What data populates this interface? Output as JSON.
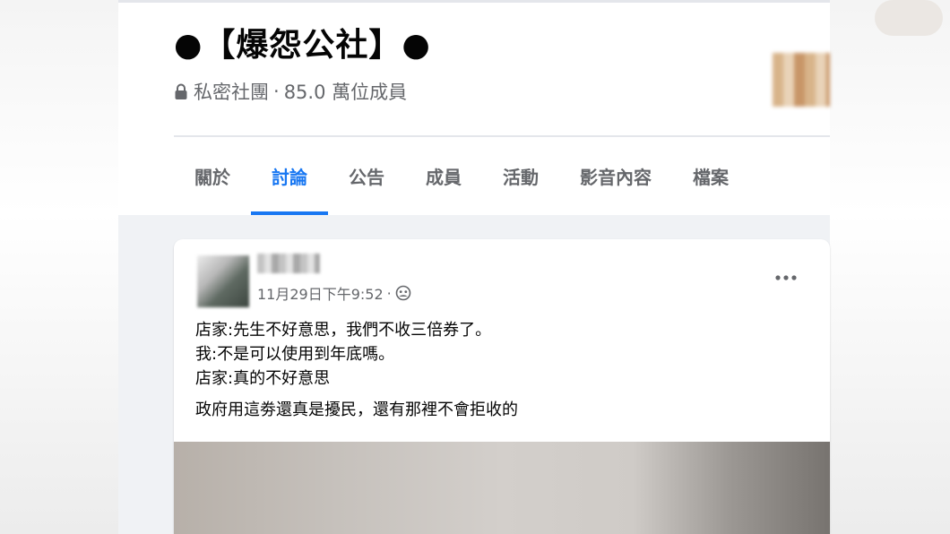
{
  "group": {
    "title": "●【爆怨公社】●",
    "privacy": "私密社團",
    "separator": "·",
    "members": "85.0 萬位成員"
  },
  "tabs": [
    {
      "label": "關於",
      "active": false
    },
    {
      "label": "討論",
      "active": true
    },
    {
      "label": "公告",
      "active": false
    },
    {
      "label": "成員",
      "active": false
    },
    {
      "label": "活動",
      "active": false
    },
    {
      "label": "影音內容",
      "active": false
    },
    {
      "label": "檔案",
      "active": false
    }
  ],
  "post": {
    "timestamp": "11月29日下午9:52",
    "separator": "·",
    "audience_icon": "group-audience-icon",
    "more_icon": "more-options-icon",
    "lines": [
      "店家:先生不好意思，我們不收三倍券了。",
      "我:不是可以使用到年底嗎。",
      "店家:真的不好意思",
      "政府用這劵還真是擾民，還有那裡不會拒收的"
    ]
  },
  "colors": {
    "accent": "#1877f2",
    "text_primary": "#050505",
    "text_secondary": "#65676b",
    "page_bg": "#f0f2f5"
  }
}
